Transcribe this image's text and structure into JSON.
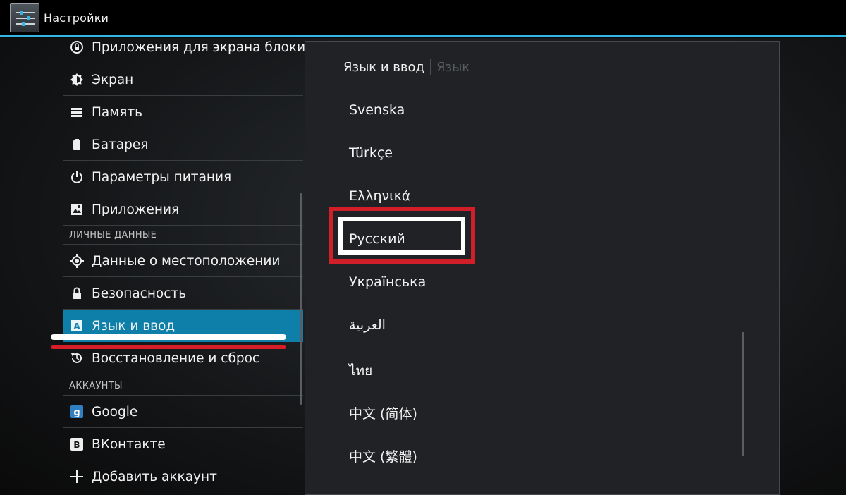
{
  "window": {
    "title": "Настройки",
    "accent_color": "#33b5e5",
    "app_icon": "settings-sliders-icon"
  },
  "sidebar": {
    "items": [
      {
        "label": "Приложения для экрана блоки",
        "icon": "lock-apps-icon"
      },
      {
        "label": "Экран",
        "icon": "brightness-icon"
      },
      {
        "label": "Память",
        "icon": "storage-icon"
      },
      {
        "label": "Батарея",
        "icon": "battery-icon"
      },
      {
        "label": "Параметры питания",
        "icon": "power-icon"
      },
      {
        "label": "Приложения",
        "icon": "apps-icon"
      }
    ],
    "section_personal": "ЛИЧНЫЕ ДАННЫЕ",
    "personal_items": [
      {
        "label": "Данные о местоположении",
        "icon": "location-icon"
      },
      {
        "label": "Безопасность",
        "icon": "lock-icon"
      },
      {
        "label": "Язык и ввод",
        "icon": "language-input-icon",
        "selected": true
      },
      {
        "label": "Восстановление и сброс",
        "icon": "backup-restore-icon"
      }
    ],
    "section_accounts": "АККАУНТЫ",
    "account_items": [
      {
        "label": "Google",
        "icon": "google-icon"
      },
      {
        "label": "ВКонтакте",
        "icon": "vkontakte-icon"
      },
      {
        "label": "Добавить аккаунт",
        "icon": "add-icon"
      }
    ],
    "selected_color": "#0e7fa8"
  },
  "panel": {
    "breadcrumb_current": "Язык и ввод",
    "breadcrumb_next": "Язык",
    "languages": [
      "Svenska",
      "Türkçe",
      "Ελληνικά",
      "Русский",
      "Українська",
      "العربية",
      "ไทย",
      "中文 (简体)",
      "中文 (繁體)"
    ],
    "highlighted_language": "Русский"
  },
  "annotation": {
    "highlight_color": "#d11f2a"
  }
}
